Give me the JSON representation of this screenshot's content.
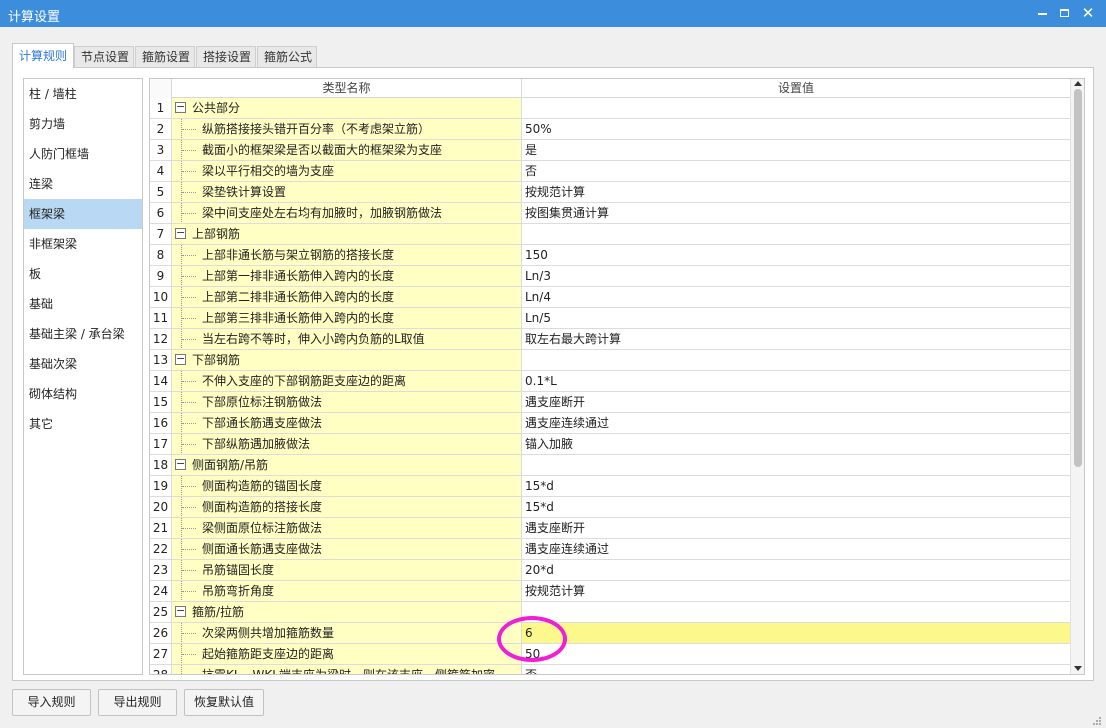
{
  "window": {
    "title": "计算设置"
  },
  "tabs": [
    "计算规则",
    "节点设置",
    "箍筋设置",
    "搭接设置",
    "箍筋公式"
  ],
  "sidebar": {
    "items": [
      "柱 / 墙柱",
      "剪力墙",
      "人防门框墙",
      "连梁",
      "框架梁",
      "非框架梁",
      "板",
      "基础",
      "基础主梁 / 承台梁",
      "基础次梁",
      "砌体结构",
      "其它"
    ],
    "selected": "框架梁"
  },
  "grid": {
    "header": {
      "name": "类型名称",
      "value": "设置值"
    },
    "rows": [
      {
        "no": "1",
        "name": "公共部分",
        "value": "",
        "group": true
      },
      {
        "no": "2",
        "name": "纵筋搭接接头错开百分率（不考虑架立筋）",
        "value": "50%"
      },
      {
        "no": "3",
        "name": "截面小的框架梁是否以截面大的框架梁为支座",
        "value": "是"
      },
      {
        "no": "4",
        "name": "梁以平行相交的墙为支座",
        "value": "否"
      },
      {
        "no": "5",
        "name": "梁垫铁计算设置",
        "value": "按规范计算"
      },
      {
        "no": "6",
        "name": "梁中间支座处左右均有加腋时，加腋钢筋做法",
        "value": "按图集贯通计算"
      },
      {
        "no": "7",
        "name": "上部钢筋",
        "value": "",
        "group": true
      },
      {
        "no": "8",
        "name": "上部非通长筋与架立钢筋的搭接长度",
        "value": "150"
      },
      {
        "no": "9",
        "name": "上部第一排非通长筋伸入跨内的长度",
        "value": "Ln/3"
      },
      {
        "no": "10",
        "name": "上部第二排非通长筋伸入跨内的长度",
        "value": "Ln/4"
      },
      {
        "no": "11",
        "name": "上部第三排非通长筋伸入跨内的长度",
        "value": "Ln/5"
      },
      {
        "no": "12",
        "name": "当左右跨不等时，伸入小跨内负筋的L取值",
        "value": "取左右最大跨计算"
      },
      {
        "no": "13",
        "name": "下部钢筋",
        "value": "",
        "group": true
      },
      {
        "no": "14",
        "name": "不伸入支座的下部钢筋距支座边的距离",
        "value": "0.1*L"
      },
      {
        "no": "15",
        "name": "下部原位标注钢筋做法",
        "value": "遇支座断开"
      },
      {
        "no": "16",
        "name": "下部通长筋遇支座做法",
        "value": "遇支座连续通过"
      },
      {
        "no": "17",
        "name": "下部纵筋遇加腋做法",
        "value": "锚入加腋"
      },
      {
        "no": "18",
        "name": "侧面钢筋/吊筋",
        "value": "",
        "group": true
      },
      {
        "no": "19",
        "name": "侧面构造筋的锚固长度",
        "value": "15*d"
      },
      {
        "no": "20",
        "name": "侧面构造筋的搭接长度",
        "value": "15*d"
      },
      {
        "no": "21",
        "name": "梁侧面原位标注筋做法",
        "value": "遇支座断开"
      },
      {
        "no": "22",
        "name": "侧面通长筋遇支座做法",
        "value": "遇支座连续通过"
      },
      {
        "no": "23",
        "name": "吊筋锚固长度",
        "value": "20*d"
      },
      {
        "no": "24",
        "name": "吊筋弯折角度",
        "value": "按规范计算"
      },
      {
        "no": "25",
        "name": "箍筋/拉筋",
        "value": "",
        "group": true
      },
      {
        "no": "26",
        "name": "次梁两侧共增加箍筋数量",
        "value": "6",
        "highlight": true
      },
      {
        "no": "27",
        "name": "起始箍筋距支座边的距离",
        "value": "50"
      },
      {
        "no": "28",
        "name": "抗震KL、WKL端支座为梁时，则在该支座一侧箍筋加密",
        "value": "否"
      }
    ]
  },
  "buttons": {
    "import": "导入规则",
    "export": "导出规则",
    "restore": "恢复默认值"
  },
  "colors": {
    "titlebar": "#3c8edc",
    "name_cell": "#ffffc4",
    "highlight": "#fcf88c",
    "annotation": "#f01ed6",
    "sidebar_selected": "#b8d8f4"
  }
}
